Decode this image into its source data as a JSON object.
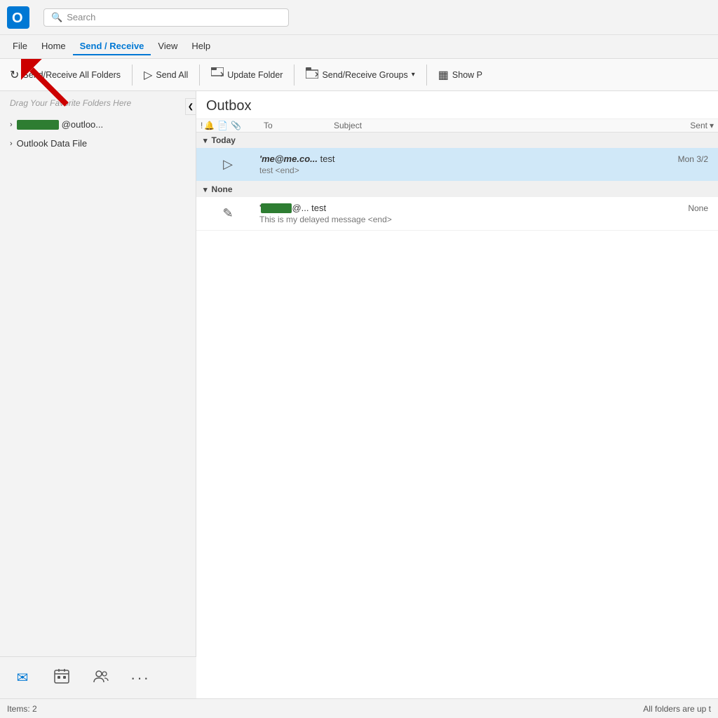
{
  "titlebar": {
    "search_placeholder": "Search"
  },
  "menubar": {
    "items": [
      {
        "label": "File",
        "active": false
      },
      {
        "label": "Home",
        "active": false
      },
      {
        "label": "Send / Receive",
        "active": true
      },
      {
        "label": "View",
        "active": false
      },
      {
        "label": "Help",
        "active": false
      }
    ]
  },
  "ribbon": {
    "buttons": [
      {
        "id": "send-receive-all",
        "label": "Send/Receive All Folders",
        "icon": "↻"
      },
      {
        "id": "send-all",
        "label": "Send All",
        "icon": "▷"
      },
      {
        "id": "update-folder",
        "label": "Update Folder",
        "icon": "📁"
      },
      {
        "id": "send-receive-groups",
        "label": "Send/Receive Groups",
        "icon": "📁",
        "dropdown": true
      },
      {
        "id": "show-progress",
        "label": "Show P",
        "icon": "▦"
      }
    ]
  },
  "sidebar": {
    "drag_hint": "Drag Your Favorite Folders Here",
    "collapse_icon": "❮",
    "account": {
      "label": "@outloo...",
      "redacted": true
    },
    "data_file": {
      "label": "Outlook Data File"
    }
  },
  "content": {
    "title": "Outbox",
    "columns": {
      "icons": "!",
      "to": "To",
      "subject": "Subject",
      "sent": "Sent"
    },
    "groups": [
      {
        "id": "today",
        "label": "Today",
        "emails": [
          {
            "id": "email-1",
            "icon": "▷",
            "sender": "'me@me.co...  test",
            "preview": "test <end>",
            "date": "Mon 3/2",
            "selected": true
          }
        ]
      },
      {
        "id": "none",
        "label": "None",
        "emails": [
          {
            "id": "email-2",
            "icon": "✎",
            "sender": "@...  test",
            "sender_redacted": true,
            "preview": "This is my delayed message <end>",
            "date": "None",
            "selected": false
          }
        ]
      }
    ]
  },
  "bottomnav": {
    "items": [
      {
        "id": "mail",
        "icon": "✉",
        "active": true
      },
      {
        "id": "calendar",
        "icon": "⊞",
        "active": false
      },
      {
        "id": "people",
        "icon": "👥",
        "active": false
      },
      {
        "id": "more",
        "icon": "···",
        "active": false
      }
    ]
  },
  "statusbar": {
    "left": "Items: 2",
    "right": "All folders are up t"
  }
}
